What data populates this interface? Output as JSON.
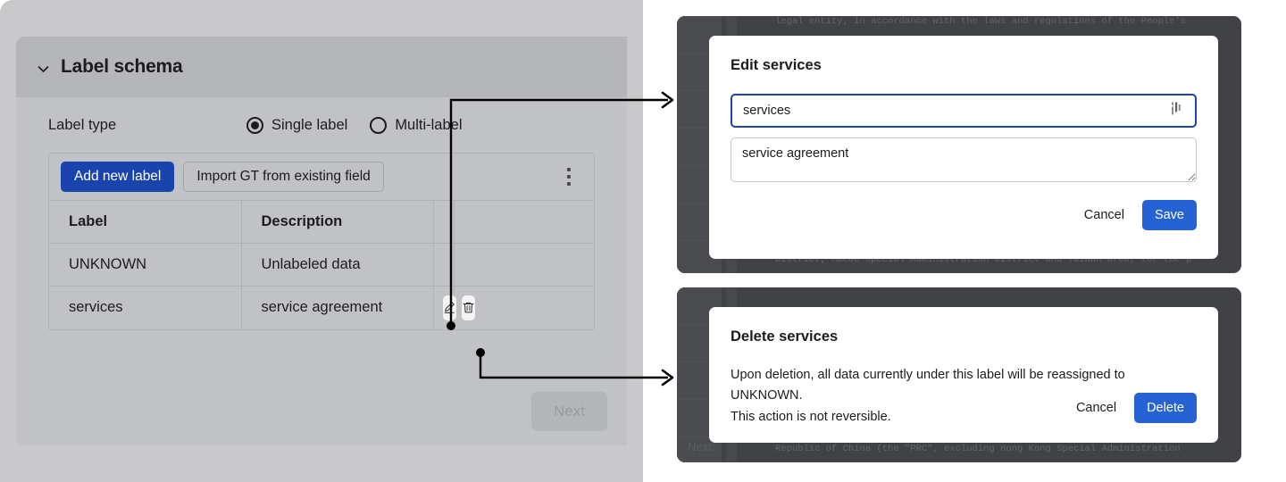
{
  "left_panel": {
    "card_title": "Label schema",
    "collapse_icon": "chevron-down-icon",
    "label_type_label": "Label type",
    "radio_options": [
      {
        "label": "Single label",
        "selected": true
      },
      {
        "label": "Multi-label",
        "selected": false
      }
    ],
    "toolbar": {
      "add_label_button": "Add new label",
      "import_button": "Import GT from existing field",
      "overflow_icon": "kebab-menu-icon"
    },
    "table": {
      "headers": [
        "Label",
        "Description",
        "",
        ""
      ],
      "rows": [
        {
          "label": "UNKNOWN",
          "description": "Unlabeled data",
          "actions": []
        },
        {
          "label": "services",
          "description": "service agreement",
          "actions": [
            "edit-icon",
            "trash-icon"
          ]
        }
      ]
    },
    "next_button": "Next"
  },
  "edit_dialog": {
    "title": "Edit services",
    "name_value": "services",
    "name_placeholder": "",
    "description_value": "service agreement",
    "description_placeholder": "",
    "cancel_label": "Cancel",
    "save_label": "Save",
    "cursor_icon": "text-cursor-icon"
  },
  "delete_dialog": {
    "title": "Delete services",
    "body_line1": "Upon deletion, all data currently under this label will be reassigned to UNKNOWN.",
    "body_line2": "This action is not reversible.",
    "cancel_label": "Cancel",
    "delete_label": "Delete"
  },
  "background_document": {
    "edit_top_line": "legal entity, in accordance with the laws and regulations of the People's",
    "edit_bottom_line": "District, Macao Special Administration District and Taiwan area, for the p",
    "delete_bottom_line": "Republic of China (the \"PRC\", excluding Hong Kong Special Administration",
    "ghost_next_label": "Next"
  },
  "colors": {
    "accent_blue": "#1a44ad",
    "dialog_blue": "#2563d4",
    "panel_gray": "#c0c2c6",
    "overlay_dark": "#404246"
  }
}
